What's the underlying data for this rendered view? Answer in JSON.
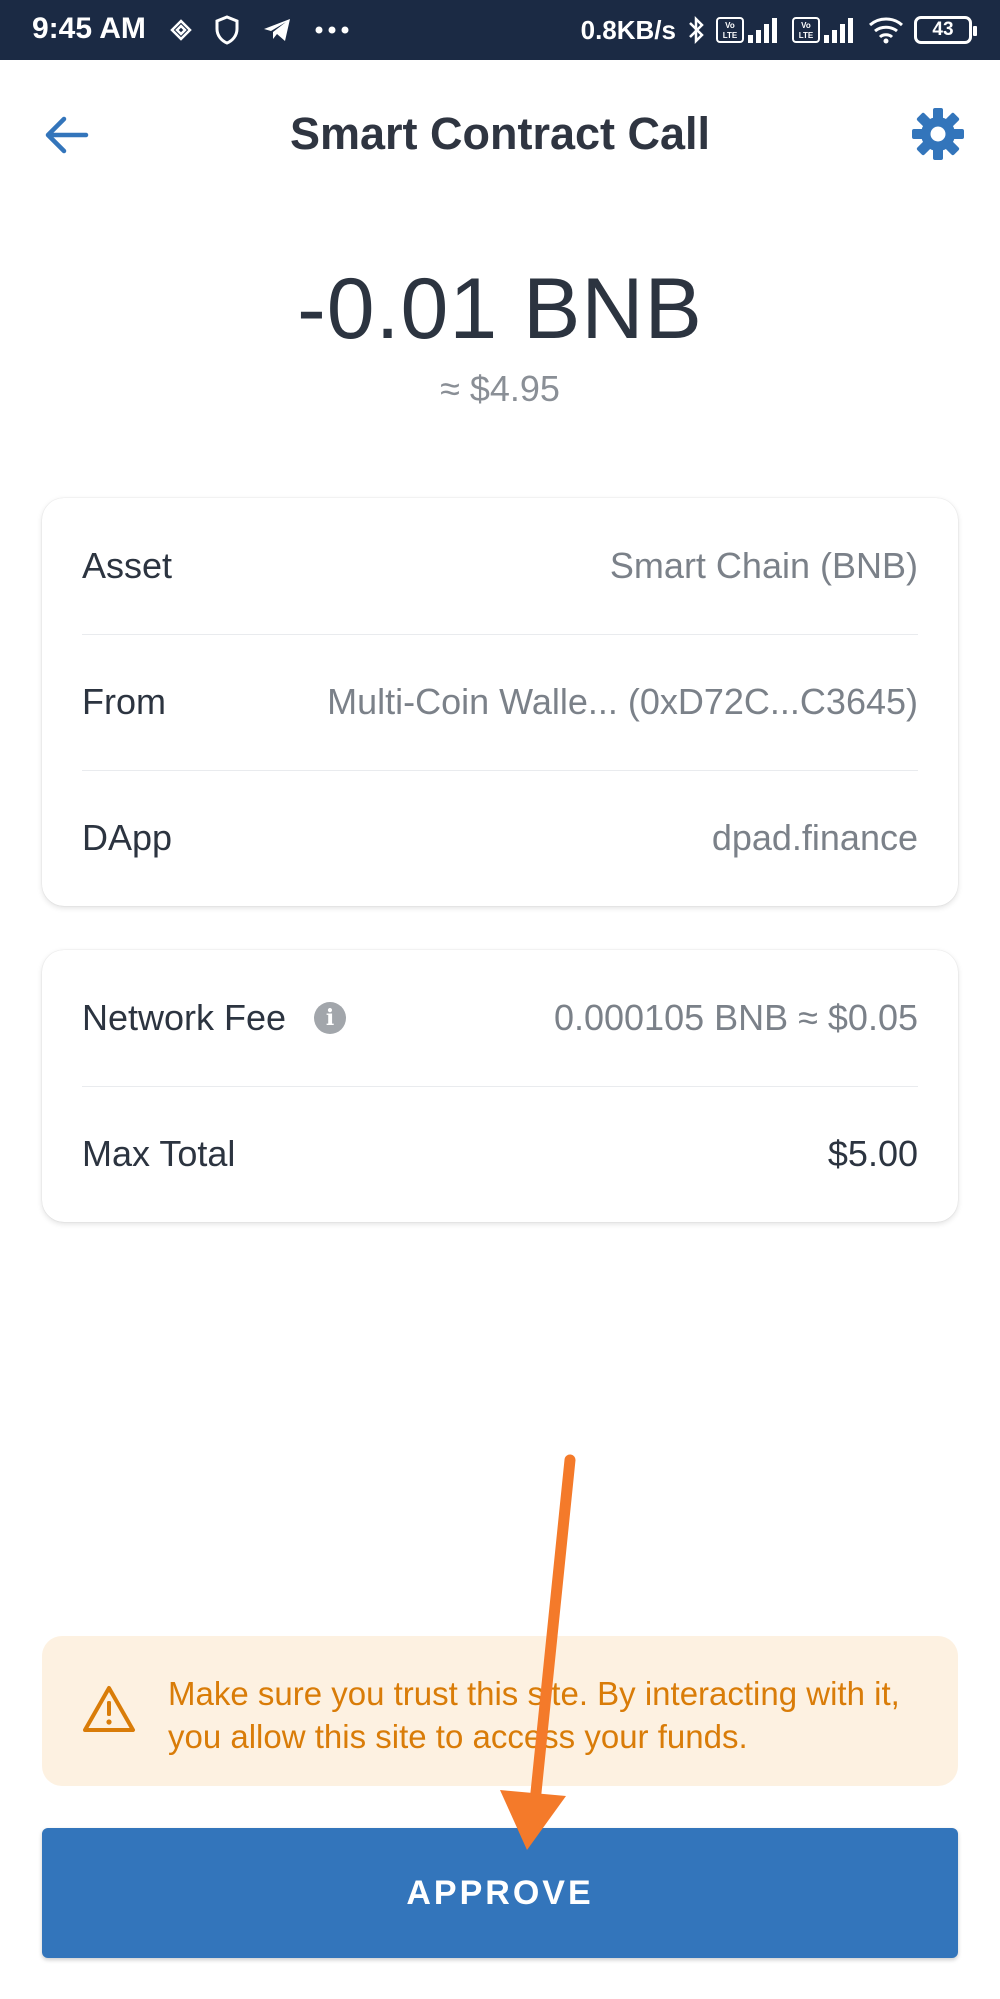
{
  "status_bar": {
    "time": "9:45 AM",
    "network_speed": "0.8KB/s",
    "battery": "43"
  },
  "header": {
    "title": "Smart Contract Call",
    "back_icon": "back-arrow-icon",
    "settings_icon": "gear-icon"
  },
  "amount": {
    "crypto": "-0.01 BNB",
    "fiat": "≈ $4.95"
  },
  "details": [
    {
      "label": "Asset",
      "value": "Smart Chain (BNB)"
    },
    {
      "label": "From",
      "value": "Multi-Coin Walle... (0xD72C...C3645)"
    },
    {
      "label": "DApp",
      "value": "dpad.finance"
    }
  ],
  "fees": [
    {
      "label": "Network Fee",
      "value": "0.000105 BNB ≈ $0.05"
    },
    {
      "label": "Max Total",
      "value": "$5.00"
    }
  ],
  "warning": {
    "text": "Make sure you trust this site. By interacting with it, you allow this site to access your funds."
  },
  "approve_button": {
    "label": "APPROVE"
  },
  "colors": {
    "accent": "#3375bb",
    "status_bar": "#1b2a44",
    "warning_bg": "#fdf1e1",
    "warning_text": "#d97c08",
    "annotation_arrow": "#f47a2a"
  }
}
